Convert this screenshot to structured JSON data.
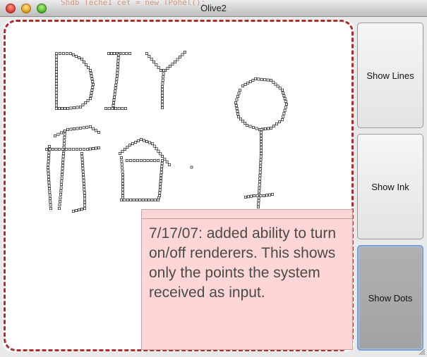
{
  "window": {
    "title": "Olive2"
  },
  "background_code": "Shdb      Teche1  cet  =  new  TPohel();",
  "sidebar": {
    "buttons": [
      {
        "label": "Show Lines",
        "active": false
      },
      {
        "label": "Show Ink",
        "active": false
      },
      {
        "label": "Show Dots",
        "active": true
      }
    ]
  },
  "note": {
    "text": "7/17/07: added ability to turn on/off renderers. This shows only the points the system received as input."
  },
  "colors": {
    "dash_border": "#b22a2a",
    "note_bg": "#ffd6d6",
    "active_button": "#aaaaaa",
    "focus_ring": "#7aa0cf"
  },
  "icons": [
    "close-icon",
    "minimize-icon",
    "zoom-icon",
    "resize-grip-icon"
  ]
}
